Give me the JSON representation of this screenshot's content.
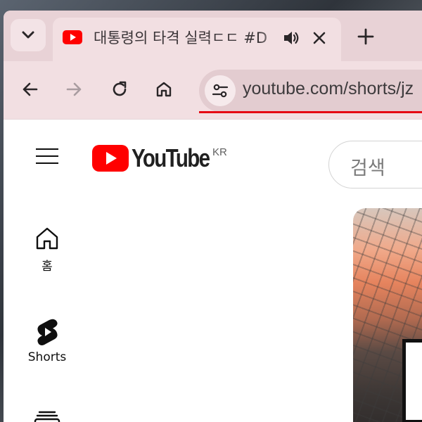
{
  "tab": {
    "title": "대통령의 타격 실력ㄷㄷ #D",
    "favicon": "youtube-favicon"
  },
  "toolbar": {
    "url": "youtube.com/shorts/jz"
  },
  "header": {
    "logo_text": "YouTube",
    "country_code": "KR",
    "search_placeholder": "검색"
  },
  "sidebar": {
    "items": [
      {
        "label": "홈",
        "icon": "home-icon"
      },
      {
        "label": "Shorts",
        "icon": "shorts-icon"
      },
      {
        "label": "",
        "icon": "subscriptions-icon"
      }
    ]
  },
  "colors": {
    "brand_red": "#ff0000",
    "url_underline": "#e50914",
    "chrome_frame": "#f2dfe2"
  }
}
